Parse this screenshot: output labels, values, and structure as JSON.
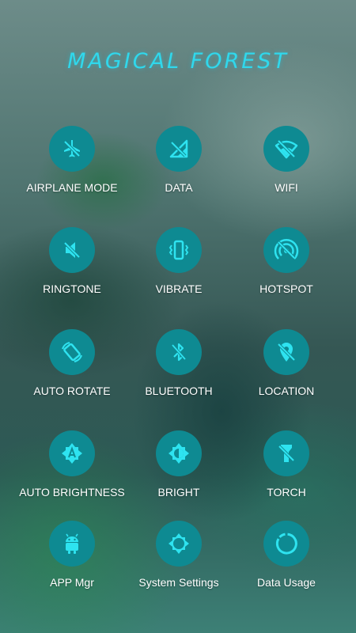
{
  "theme": {
    "title": "MAGICAL FOREST",
    "accent_color": "#30d8ec",
    "circle_color": "#0e8a92",
    "icon_color": "#2ee3f0"
  },
  "toggles": [
    {
      "label": "AIRPLANE MODE",
      "icon": "airplane-off-icon"
    },
    {
      "label": "DATA",
      "icon": "data-off-icon"
    },
    {
      "label": "WIFI",
      "icon": "wifi-off-icon"
    },
    {
      "label": "RINGTONE",
      "icon": "ringtone-off-icon"
    },
    {
      "label": "VIBRATE",
      "icon": "vibrate-icon"
    },
    {
      "label": "HOTSPOT",
      "icon": "hotspot-off-icon"
    },
    {
      "label": "AUTO ROTATE",
      "icon": "auto-rotate-icon"
    },
    {
      "label": "BLUETOOTH",
      "icon": "bluetooth-off-icon"
    },
    {
      "label": "LOCATION",
      "icon": "location-off-icon"
    },
    {
      "label": "AUTO BRIGHTNESS",
      "icon": "auto-brightness-icon"
    },
    {
      "label": "BRIGHT",
      "icon": "brightness-icon"
    },
    {
      "label": "TORCH",
      "icon": "torch-off-icon"
    },
    {
      "label": "APP Mgr",
      "icon": "android-icon"
    },
    {
      "label": "System Settings",
      "icon": "settings-gear-icon"
    },
    {
      "label": "Data Usage",
      "icon": "data-usage-icon"
    }
  ]
}
